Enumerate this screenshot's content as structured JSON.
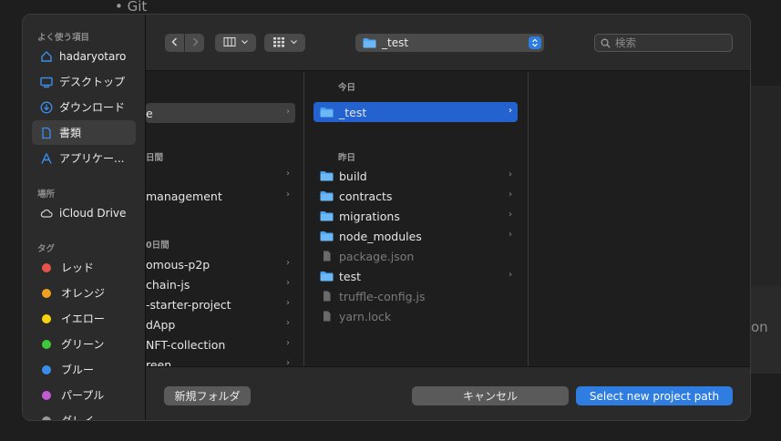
{
  "background": {
    "bullet_text": "Git",
    "right_text": "on"
  },
  "sidebar": {
    "sections": {
      "favorites": "よく使う項目",
      "locations": "場所",
      "tags": "タグ"
    },
    "favorites": [
      {
        "label": "hadaryotaro",
        "icon": "house-icon"
      },
      {
        "label": "デスクトップ",
        "icon": "desktop-icon"
      },
      {
        "label": "ダウンロード",
        "icon": "download-icon"
      },
      {
        "label": "書類",
        "icon": "document-icon"
      },
      {
        "label": "アプリケー...",
        "icon": "app-icon"
      }
    ],
    "locations": [
      {
        "label": "iCloud Drive",
        "icon": "cloud-icon"
      }
    ],
    "tags": [
      {
        "label": "レッド",
        "color": "#e5534b"
      },
      {
        "label": "オレンジ",
        "color": "#f0a020"
      },
      {
        "label": "イエロー",
        "color": "#f5d40f"
      },
      {
        "label": "グリーン",
        "color": "#3fc93a"
      },
      {
        "label": "ブルー",
        "color": "#3b8ee8"
      },
      {
        "label": "パープル",
        "color": "#c55ad6"
      },
      {
        "label": "グレイ",
        "color": "#9a9a9a"
      }
    ]
  },
  "toolbar": {
    "path_label": "_test",
    "search_placeholder": "検索"
  },
  "browser": {
    "col1": {
      "selected": "e",
      "group_a_head": "日間",
      "group_a": [
        "",
        "management"
      ],
      "group_b_head": "0日間",
      "group_b": [
        "omous-p2p",
        "chain-js",
        "-starter-project",
        "dApp",
        "NFT-collection",
        "reen"
      ]
    },
    "col2": {
      "head_today": "今日",
      "today": [
        {
          "label": "_test",
          "type": "folder"
        }
      ],
      "head_yesterday": "昨日",
      "yesterday": [
        {
          "label": "build",
          "type": "folder"
        },
        {
          "label": "contracts",
          "type": "folder"
        },
        {
          "label": "migrations",
          "type": "folder"
        },
        {
          "label": "node_modules",
          "type": "folder"
        },
        {
          "label": "package.json",
          "type": "file"
        },
        {
          "label": "test",
          "type": "folder"
        },
        {
          "label": "truffle-config.js",
          "type": "file"
        },
        {
          "label": "yarn.lock",
          "type": "file"
        }
      ]
    }
  },
  "bottom": {
    "new_folder": "新規フォルダ",
    "cancel": "キャンセル",
    "confirm": "Select new project path"
  },
  "colors": {
    "accent": "#2f7de1",
    "selection": "#2463cf",
    "folder": "#4ba3f0"
  }
}
